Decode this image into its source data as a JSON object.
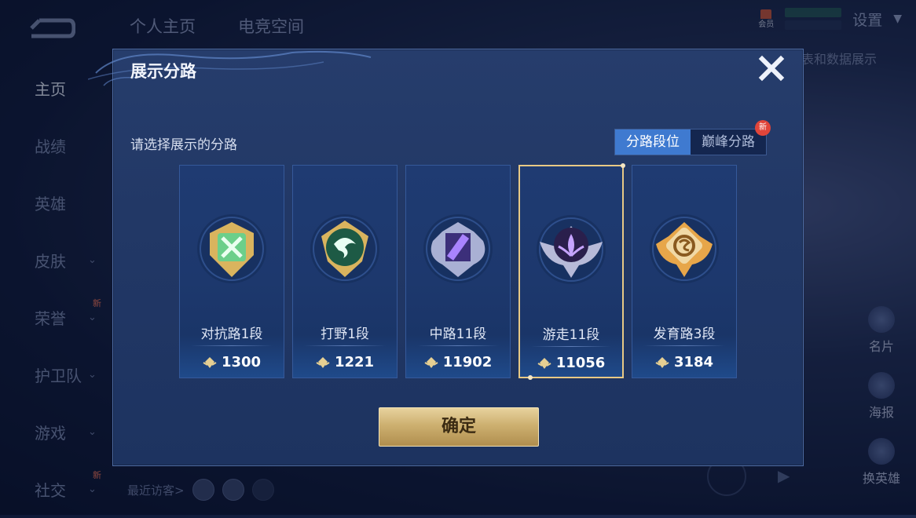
{
  "top_tabs": [
    "个人主页",
    "电竞空间"
  ],
  "top_right": {
    "vip_label": "会员",
    "settings_label": "设置"
  },
  "background_snippet": "表和数据展示",
  "sidebar": {
    "items": [
      {
        "label": "主页",
        "active": true,
        "chevron": false,
        "new": false
      },
      {
        "label": "战绩",
        "active": false,
        "chevron": false,
        "new": false
      },
      {
        "label": "英雄",
        "active": false,
        "chevron": false,
        "new": false
      },
      {
        "label": "皮肤",
        "active": false,
        "chevron": true,
        "new": false
      },
      {
        "label": "荣誉",
        "active": false,
        "chevron": true,
        "new": true
      },
      {
        "label": "护卫队",
        "active": false,
        "chevron": true,
        "new": false
      },
      {
        "label": "游戏",
        "active": false,
        "chevron": true,
        "new": false
      },
      {
        "label": "社交",
        "active": false,
        "chevron": true,
        "new": true
      }
    ],
    "new_tag": "新"
  },
  "right_icons": [
    {
      "label": "名片",
      "new": true
    },
    {
      "label": "海报",
      "new": false
    },
    {
      "label": "换英雄",
      "new": false
    }
  ],
  "recent_visitors_label": "最近访客>",
  "modal": {
    "title": "展示分路",
    "subtitle": "请选择展示的分路",
    "toggle": {
      "active": "分路段位",
      "inactive": "巅峰分路",
      "new_badge": "新"
    },
    "cards": [
      {
        "label": "对抗路1段",
        "value": "1300",
        "icon": "sword-badge-icon",
        "color": "#6ccf8a",
        "selected": false
      },
      {
        "label": "打野1段",
        "value": "1221",
        "icon": "dragon-badge-icon",
        "color": "#45c78b",
        "selected": false
      },
      {
        "label": "中路11段",
        "value": "11902",
        "icon": "crystal-badge-icon",
        "color": "#a983ff",
        "selected": false
      },
      {
        "label": "游走11段",
        "value": "11056",
        "icon": "wings-badge-icon",
        "color": "#c6a4ff",
        "selected": true
      },
      {
        "label": "发育路3段",
        "value": "3184",
        "icon": "coin-badge-icon",
        "color": "#e7a64a",
        "selected": false
      }
    ],
    "confirm_label": "确定"
  },
  "colors": {
    "accent_blue": "#3f7ad0",
    "gold": "#e8c985",
    "new_red": "#e0453a"
  }
}
